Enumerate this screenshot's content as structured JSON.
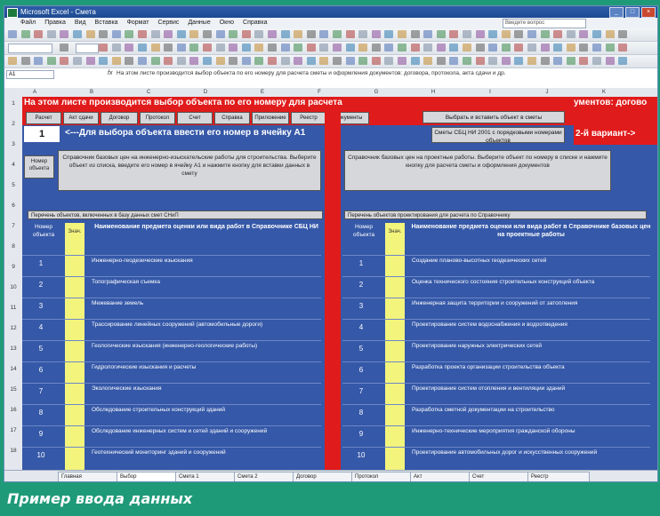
{
  "window": {
    "title": "Microsoft Excel - Смета"
  },
  "menu": [
    "Файл",
    "Правка",
    "Вид",
    "Вставка",
    "Формат",
    "Сервис",
    "Данные",
    "Окно",
    "Справка"
  ],
  "help_placeholder": "Введите вопрос",
  "formula": {
    "namebox": "A1",
    "fx": "fx",
    "text": "На этом листе производится выбор объекта по его номеру для расчета сметы и оформления документов: договора, протокола, акта сдачи и др."
  },
  "banner": {
    "left": "На этом листе производится выбор объекта по его номеру для расчета",
    "right": "ументов: догово"
  },
  "buttons": [
    "Расчет",
    "Акт сдачи",
    "Договор",
    "Протокол",
    "Счет",
    "Справка",
    "Приложение",
    "Реестр",
    "Документы"
  ],
  "topright_button": "Выбрать и вставить объект в сметы",
  "row1": {
    "number": "1",
    "hint": "<---Для выбора объекта ввести его номер в ячейку А1",
    "center_button": "Сметы СБЦ НИ 2001 с порядковыми номерами объектов",
    "hint2": "2-й вариант->"
  },
  "left_desc": "Справочник базовых цен на инженерно-изыскательские работы для строительства. Выберите объект из списка, введите его номер в ячейку А1 и нажмите кнопку для вставки данных в смету",
  "right_desc": "Справочник базовых цен на проектные работы. Выберите объект по номеру в списке и нажмите кнопку для расчета сметы и оформления документов",
  "small_button": "Номер объекта",
  "strip_left": "Перечень объектов, включенных в базу данных смет СНиП",
  "strip_right": "Перечень объектов проектирования для расчета по Справочнику",
  "left_table": {
    "head_num": "Номер объекта",
    "head_val": "Знач.",
    "head_desc": "Наименование предмета оценки или вида работ в Справочнике СБЦ НИ",
    "rows": [
      {
        "n": "1",
        "v": "",
        "d": "Инженерно-геодезические изыскания"
      },
      {
        "n": "2",
        "v": "",
        "d": "Топографическая съемка"
      },
      {
        "n": "3",
        "v": "",
        "d": "Межевание земель"
      },
      {
        "n": "4",
        "v": "",
        "d": "Трассирование линейных сооружений (автомобильные дороги)"
      },
      {
        "n": "5",
        "v": "",
        "d": "Геологические изыскания (инженерно-геологические работы)"
      },
      {
        "n": "6",
        "v": "",
        "d": "Гидрологические изыскания и расчеты"
      },
      {
        "n": "7",
        "v": "",
        "d": "Экологические изыскания"
      },
      {
        "n": "8",
        "v": "",
        "d": "Обследование строительных конструкций зданий"
      },
      {
        "n": "9",
        "v": "",
        "d": "Обследование инженерных систем и сетей зданий и сооружений"
      },
      {
        "n": "10",
        "v": "",
        "d": "Геотехнический мониторинг зданий и сооружений"
      }
    ]
  },
  "right_table": {
    "head_num": "Номер объекта",
    "head_val": "Знач.",
    "head_desc": "Наименование предмета оценки или вида работ в Справочнике базовых цен на проектные работы",
    "rows": [
      {
        "n": "1",
        "v": "",
        "d": "Создание планово-высотных геодезических сетей"
      },
      {
        "n": "2",
        "v": "",
        "d": "Оценка технического состояния строительных конструкций объекта"
      },
      {
        "n": "3",
        "v": "",
        "d": "Инженерная защита территории и сооружений от затопления"
      },
      {
        "n": "4",
        "v": "",
        "d": "Проектирование систем водоснабжения и водоотведения"
      },
      {
        "n": "5",
        "v": "",
        "d": "Проектирование наружных электрических сетей"
      },
      {
        "n": "6",
        "v": "",
        "d": "Разработка проекта организации строительства объекта"
      },
      {
        "n": "7",
        "v": "",
        "d": "Проектирование систем отопления и вентиляции зданий"
      },
      {
        "n": "8",
        "v": "",
        "d": "Разработка сметной документации на строительство"
      },
      {
        "n": "9",
        "v": "",
        "d": "Инженерно-технические мероприятия гражданской обороны"
      },
      {
        "n": "10",
        "v": "",
        "d": "Проектирование автомобильных дорог и искусственных сооружений"
      }
    ]
  },
  "sheet_tabs": [
    "Главная",
    "Выбор",
    "Смета 1",
    "Смета 2",
    "Договор",
    "Протокол",
    "Акт",
    "Счет",
    "Реестр"
  ],
  "caption": "Пример ввода данных"
}
